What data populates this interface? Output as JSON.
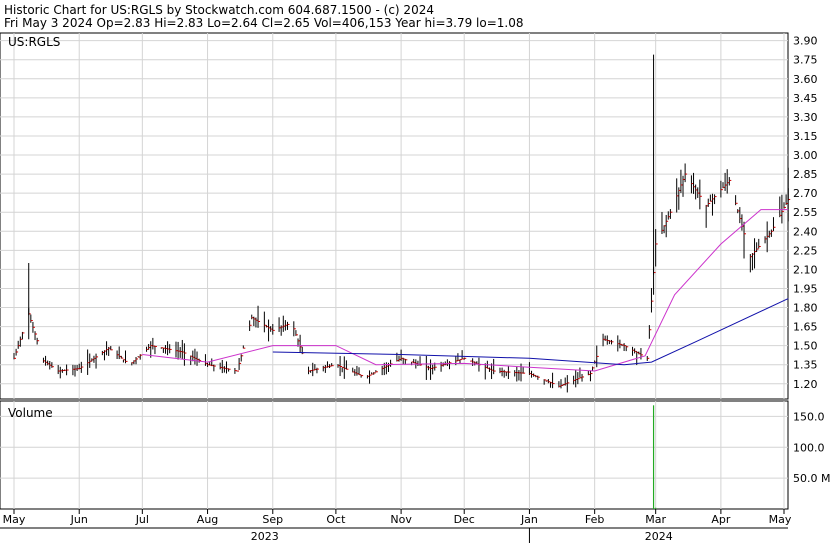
{
  "header": {
    "line1": "Historic Chart for US:RGLS by Stockwatch.com 604.687.1500 - (c) 2024",
    "line2": "Fri May  3 2024  Op=2.83  Hi=2.83  Lo=2.64  Cl=2.65  Vol=406,153  Year hi=3.79  lo=1.08"
  },
  "symbol_label": "US:RGLS",
  "volume_label": "Volume",
  "colors": {
    "bar": "#000000",
    "close_tick": "#cc0000",
    "ma_short": "#cc33cc",
    "ma_long": "#1111aa",
    "volume": "#22aa22",
    "grid": "#d4d4d4"
  },
  "chart_data": [
    {
      "type": "ohlc",
      "title": "Historic Chart for US:RGLS by Stockwatch.com 604.687.1500 - (c) 2024",
      "ylim": [
        1.08,
        3.96
      ],
      "y_ticks": [
        "3.90",
        "3.75",
        "3.60",
        "3.45",
        "3.30",
        "3.15",
        "3.00",
        "2.85",
        "2.70",
        "2.55",
        "2.40",
        "2.25",
        "2.10",
        "1.95",
        "1.80",
        "1.65",
        "1.50",
        "1.35",
        "1.20"
      ],
      "x_months": [
        "May",
        "Jun",
        "Jul",
        "Aug",
        "Sep",
        "Oct",
        "Nov",
        "Dec",
        "Jan",
        "Feb",
        "Mar",
        "Apr",
        "May"
      ],
      "x_years": [
        "2023",
        "2024"
      ],
      "last_bar": {
        "date": "2024-05-03",
        "open": 2.83,
        "high": 2.83,
        "low": 2.64,
        "close": 2.65,
        "volume": 406153
      },
      "year_high": 3.79,
      "year_low": 1.08,
      "close_series": [
        {
          "date": "2023-05-01",
          "close": 1.4
        },
        {
          "date": "2023-05-08",
          "close": 1.75
        },
        {
          "date": "2023-05-15",
          "close": 1.38
        },
        {
          "date": "2023-05-22",
          "close": 1.3
        },
        {
          "date": "2023-06-01",
          "close": 1.32
        },
        {
          "date": "2023-06-15",
          "close": 1.48
        },
        {
          "date": "2023-06-25",
          "close": 1.35
        },
        {
          "date": "2023-07-05",
          "close": 1.5
        },
        {
          "date": "2023-07-20",
          "close": 1.45
        },
        {
          "date": "2023-08-01",
          "close": 1.35
        },
        {
          "date": "2023-08-15",
          "close": 1.3
        },
        {
          "date": "2023-08-22",
          "close": 1.72
        },
        {
          "date": "2023-09-01",
          "close": 1.62
        },
        {
          "date": "2023-09-10",
          "close": 1.68
        },
        {
          "date": "2023-09-18",
          "close": 1.3
        },
        {
          "date": "2023-10-01",
          "close": 1.35
        },
        {
          "date": "2023-10-15",
          "close": 1.25
        },
        {
          "date": "2023-11-01",
          "close": 1.4
        },
        {
          "date": "2023-11-15",
          "close": 1.32
        },
        {
          "date": "2023-12-01",
          "close": 1.4
        },
        {
          "date": "2023-12-15",
          "close": 1.3
        },
        {
          "date": "2024-01-01",
          "close": 1.28
        },
        {
          "date": "2024-01-15",
          "close": 1.18
        },
        {
          "date": "2024-01-30",
          "close": 1.28
        },
        {
          "date": "2024-02-05",
          "close": 1.55
        },
        {
          "date": "2024-02-15",
          "close": 1.5
        },
        {
          "date": "2024-02-26",
          "close": 1.4
        },
        {
          "date": "2024-03-01",
          "close": 2.3
        },
        {
          "date": "2024-03-08",
          "close": 2.55
        },
        {
          "date": "2024-03-15",
          "close": 2.85
        },
        {
          "date": "2024-03-25",
          "close": 2.6
        },
        {
          "date": "2024-04-05",
          "close": 2.8
        },
        {
          "date": "2024-04-15",
          "close": 2.2
        },
        {
          "date": "2024-04-25",
          "close": 2.4
        },
        {
          "date": "2024-05-03",
          "close": 2.65
        }
      ],
      "ma_short": [
        {
          "date": "2023-07-01",
          "value": 1.43
        },
        {
          "date": "2023-08-01",
          "value": 1.37
        },
        {
          "date": "2023-09-01",
          "value": 1.5
        },
        {
          "date": "2023-10-01",
          "value": 1.5
        },
        {
          "date": "2023-10-20",
          "value": 1.35
        },
        {
          "date": "2023-12-01",
          "value": 1.36
        },
        {
          "date": "2024-01-01",
          "value": 1.33
        },
        {
          "date": "2024-02-01",
          "value": 1.3
        },
        {
          "date": "2024-02-25",
          "value": 1.42
        },
        {
          "date": "2024-03-10",
          "value": 1.9
        },
        {
          "date": "2024-04-01",
          "value": 2.3
        },
        {
          "date": "2024-04-20",
          "value": 2.57
        },
        {
          "date": "2024-05-03",
          "value": 2.57
        }
      ],
      "ma_long": [
        {
          "date": "2023-09-01",
          "value": 1.45
        },
        {
          "date": "2023-11-01",
          "value": 1.43
        },
        {
          "date": "2024-01-01",
          "value": 1.4
        },
        {
          "date": "2024-02-15",
          "value": 1.35
        },
        {
          "date": "2024-02-28",
          "value": 1.37
        },
        {
          "date": "2024-03-20",
          "value": 1.53
        },
        {
          "date": "2024-05-03",
          "value": 1.87
        }
      ]
    },
    {
      "type": "bar",
      "title": "Volume",
      "ylim": [
        0,
        175
      ],
      "y_ticks": [
        "150.0",
        "100.0",
        "50.0 M"
      ],
      "values": [
        {
          "date": "2024-02-29",
          "volume_m": 168
        },
        {
          "date": "2024-03-01",
          "volume_m": 2
        }
      ]
    }
  ]
}
